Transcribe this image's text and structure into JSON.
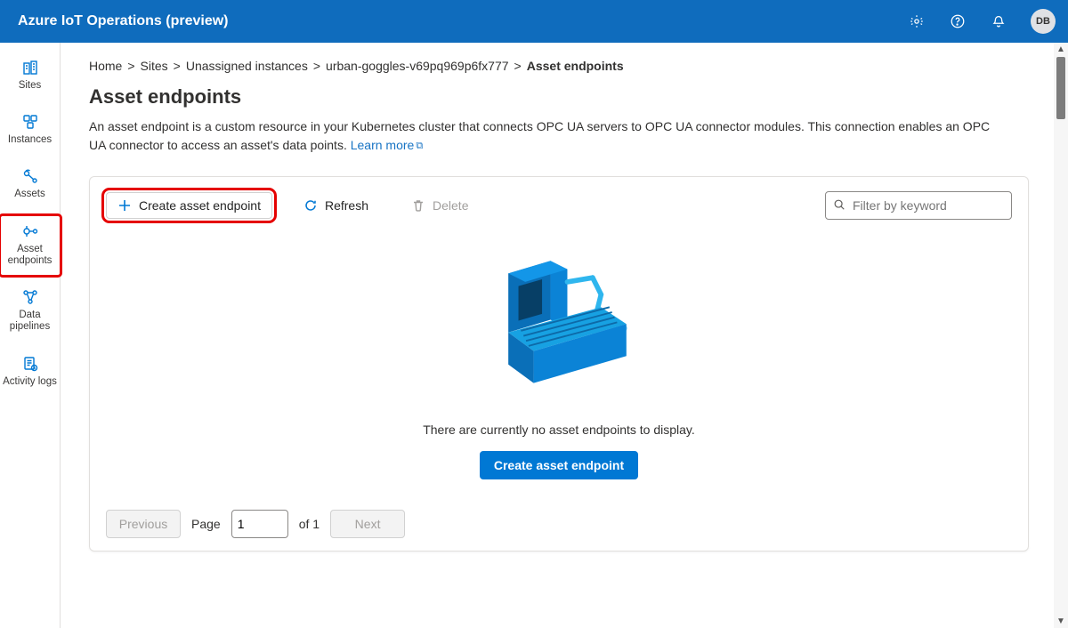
{
  "header": {
    "title": "Azure IoT Operations (preview)",
    "avatar_initials": "DB"
  },
  "nav": {
    "items": [
      {
        "id": "sites",
        "label": "Sites"
      },
      {
        "id": "instances",
        "label": "Instances"
      },
      {
        "id": "assets",
        "label": "Assets"
      },
      {
        "id": "asset-endpoints",
        "label": "Asset endpoints",
        "highlighted": true
      },
      {
        "id": "data-pipelines",
        "label": "Data pipelines"
      },
      {
        "id": "activity-logs",
        "label": "Activity logs"
      }
    ]
  },
  "breadcrumb": {
    "items": [
      {
        "label": "Home"
      },
      {
        "label": "Sites"
      },
      {
        "label": "Unassigned instances"
      },
      {
        "label": "urban-goggles-v69pq969p6fx777"
      },
      {
        "label": "Asset endpoints",
        "current": true
      }
    ],
    "separator": ">"
  },
  "page": {
    "title": "Asset endpoints",
    "description": "An asset endpoint is a custom resource in your Kubernetes cluster that connects OPC UA servers to OPC UA connector modules. This connection enables an OPC UA connector to access an asset's data points.",
    "learn_more_label": "Learn more"
  },
  "toolbar": {
    "create_label": "Create asset endpoint",
    "refresh_label": "Refresh",
    "delete_label": "Delete",
    "search_placeholder": "Filter by keyword"
  },
  "empty_state": {
    "message": "There are currently no asset endpoints to display.",
    "cta_label": "Create asset endpoint"
  },
  "pager": {
    "previous_label": "Previous",
    "next_label": "Next",
    "page_label": "Page",
    "of_label": "of",
    "page_value": "1",
    "page_count": "1"
  }
}
